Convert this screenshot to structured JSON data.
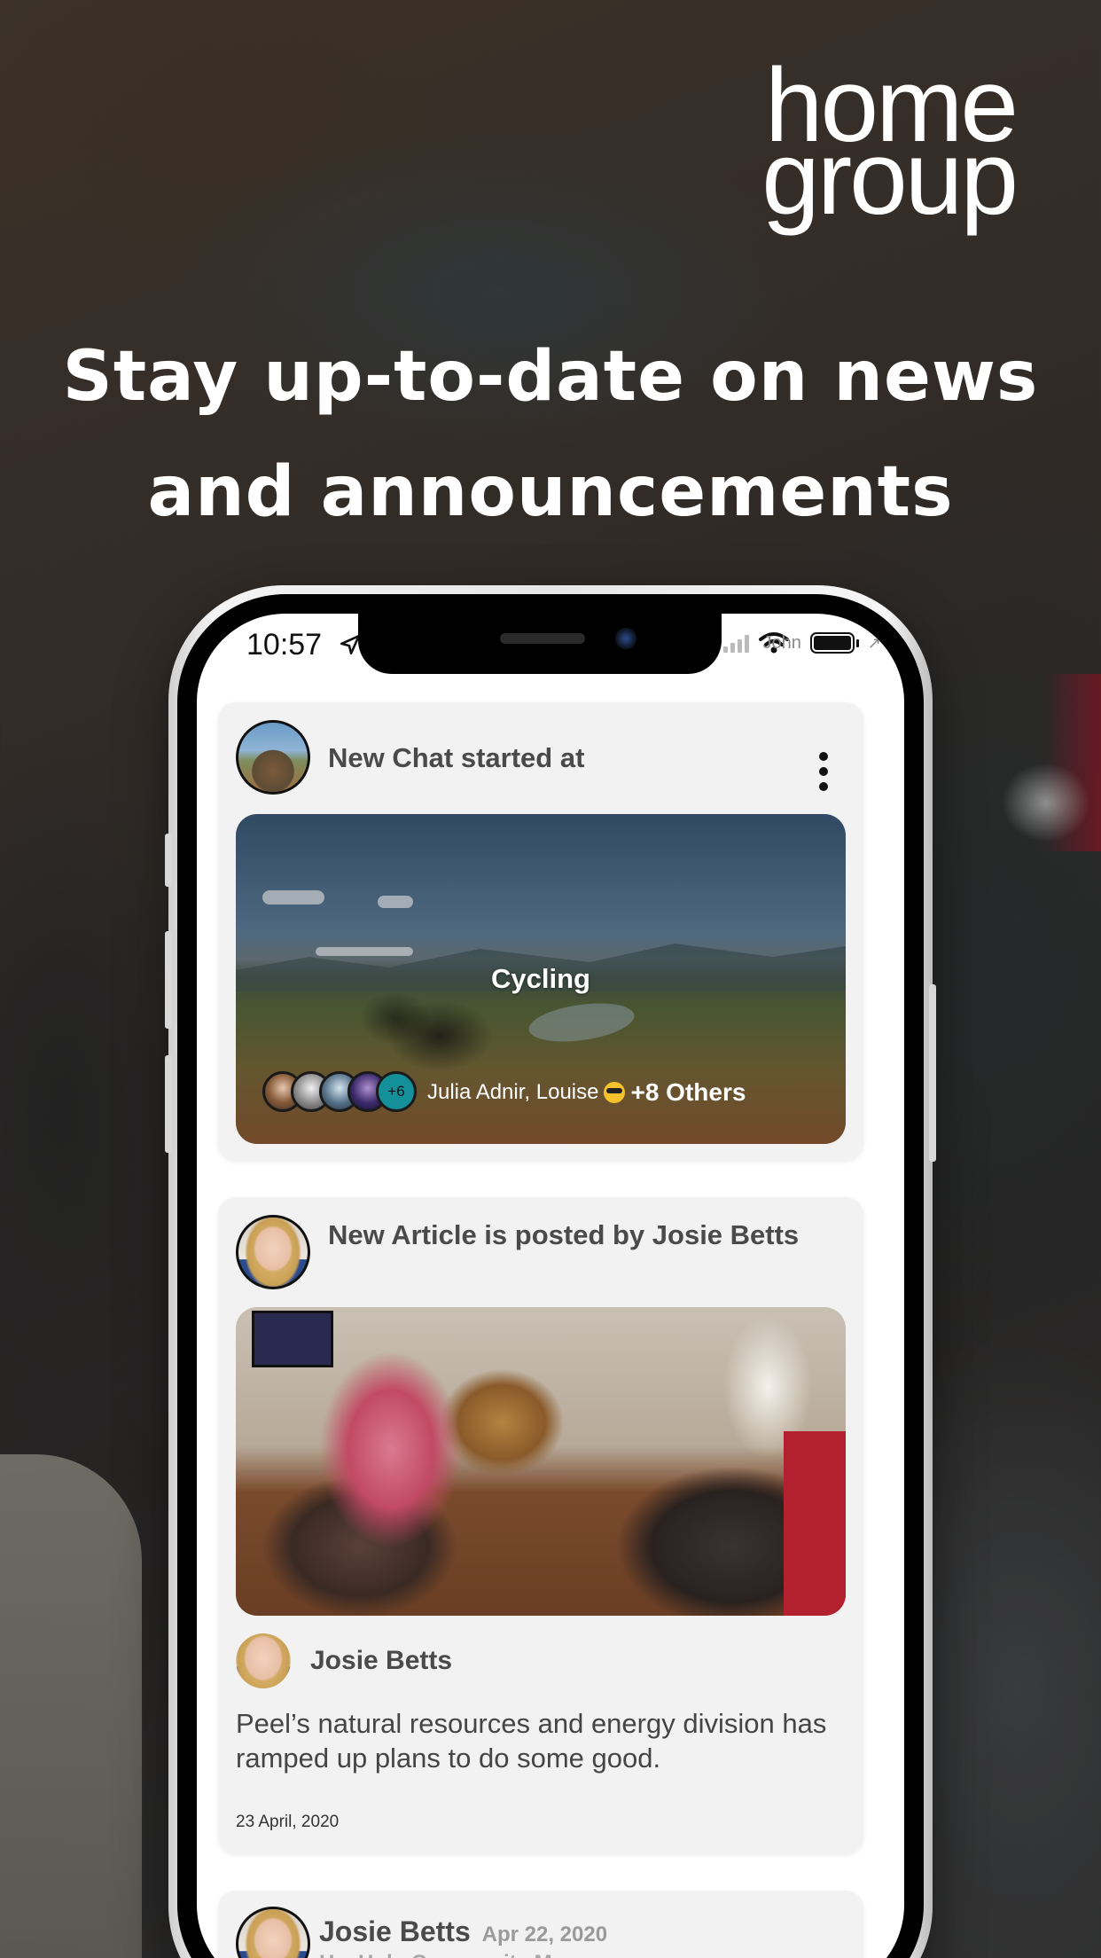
{
  "logo": {
    "line1": "home",
    "line2": "group"
  },
  "headline": {
    "line1": "Stay up-to-date on news",
    "line2": "and announcements"
  },
  "status_bar": {
    "time": "10:57",
    "carrier": "John"
  },
  "feed": {
    "chat_card": {
      "heading": "New Chat started at",
      "chat_title": "Cycling",
      "member_overflow": "+6",
      "members_text": "Julia Adnir, Louise",
      "others_text": "+8 Others"
    },
    "article_card": {
      "heading": "New Article is posted by Josie Betts",
      "author": "Josie Betts",
      "text": "Peel’s natural resources and energy division has ramped up plans to do some good.",
      "date": "23 April, 2020"
    },
    "post_card": {
      "author": "Josie Betts",
      "date": "Apr 22, 2020",
      "role": "HeyHub, Community Manager"
    }
  },
  "colors": {
    "accent_teal": "#14909a",
    "card_bg": "#f2f2f2",
    "text_dark": "#4a4a4a"
  }
}
